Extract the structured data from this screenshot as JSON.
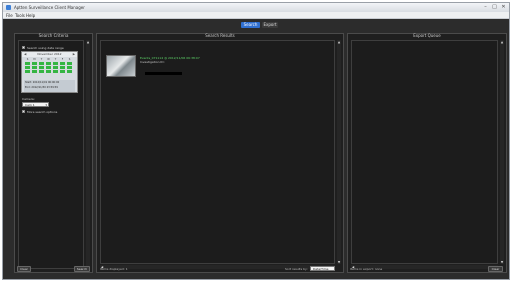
{
  "window": {
    "title": "Aptten Surveillance Client Manager",
    "controls": {
      "minimize": "–",
      "maximize": "□",
      "close": "✕"
    }
  },
  "menu": {
    "items": [
      "File",
      "Tools",
      "Help"
    ]
  },
  "tabs": [
    {
      "label": "Search",
      "active": true
    },
    {
      "label": "Export",
      "active": false
    }
  ],
  "search_criteria": {
    "title": "Search Criteria",
    "use_date_range_label": "Search using date range",
    "calendar": {
      "month_label": "November 2012",
      "day_names": [
        "S",
        "M",
        "T",
        "W",
        "T",
        "F",
        "S"
      ],
      "rows": [
        "Start:  2012/11/01  00:00:00",
        "End:    2012/11/30  23:59:59"
      ]
    },
    "camera_label": "Camera:",
    "camera_value": "Cam 1",
    "more_label": "More search options",
    "footer_left_button": "Clear",
    "footer_right_button": "Search"
  },
  "search_results": {
    "title": "Search Results",
    "item": {
      "line1": "Events_071114 @ 2012/11/06 06:38:07",
      "line2": "Investigation ID:"
    },
    "status_left": "Items displayed: 1",
    "sort_label": "Sort results by:",
    "sort_value": "Date/Time"
  },
  "export_queue": {
    "title": "Export Queue",
    "status_left": "Items in export: none",
    "footer_button": "Clear"
  },
  "colors": {
    "accent": "#2f6fd0",
    "calendar_highlight": "#35b543",
    "result_text": "#5fd86a"
  }
}
